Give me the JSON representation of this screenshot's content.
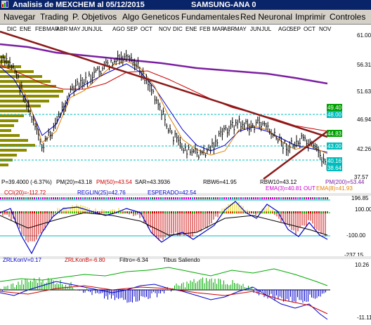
{
  "window": {
    "title": "Analisis de MEXCHEM al 05/12/2015",
    "subtitle": "SAMSUNG-ANA 0"
  },
  "menu": [
    "Navegar",
    "Trading",
    "P. Objetivos",
    "Algo Geneticos",
    "Fundamentales",
    "Red Neuronal",
    "Imprimir",
    "Controles"
  ],
  "colors": {
    "price_bars": "#000000",
    "trend_line": "#8b1a1a",
    "ma_purple": "#7b1fa2",
    "ma_red": "#cc0000",
    "ma_blue": "#0000cc",
    "ma_orange": "#e08000",
    "volume_profile": "#8b8b00",
    "level_cyan": "#00aaaa"
  },
  "price_panel": {
    "months": [
      "DIC",
      "ENE",
      "FEB",
      "MAR",
      "ABR",
      "MAY",
      "JUN",
      "JUL",
      "AGO",
      "SEP",
      "OCT",
      "NOV",
      "DIC",
      "ENE",
      "FEB",
      "MAR",
      "ABR",
      "MAY",
      "JUN",
      "JUL",
      "AGO",
      "SEP",
      "OCT",
      "NOV"
    ],
    "y_ticks": [
      "61.00",
      "56.31",
      "51.63",
      "46.94",
      "42.26",
      "37.57"
    ],
    "level_boxes": [
      {
        "label": "49.40",
        "color": "#00a000"
      },
      {
        "label": "48.00",
        "color": "#00bcbc"
      },
      {
        "label": "44.83",
        "color": "#00a000"
      },
      {
        "label": "43.00",
        "color": "#00bcbc"
      },
      {
        "label": "40.16",
        "color": "#00bcbc"
      },
      {
        "label": "38.64",
        "color": "#00bcbc"
      }
    ],
    "stats_line": [
      "P=39.4000 (-6.37%)",
      "PM(20)=43.18",
      "PM(50)=43.54",
      "SAR=43.3936",
      "RBW6=41.95",
      "RBW10=43.12",
      "PM(200)=53.44"
    ],
    "ema_line": [
      "EMA(3)=40.81 OUT",
      "EMA(8)=41.93"
    ]
  },
  "cci_panel": {
    "labels": [
      "CCI(20)=-112.72",
      "REGLIN(25)=42.76",
      "ESPERADO=42.54"
    ],
    "y_ticks": [
      "196.85",
      "100.00",
      "-100.00",
      "-237.15"
    ]
  },
  "zrl_panel": {
    "labels": [
      "ZRLKonV=0.17",
      "ZRLKonB=-6.80",
      "Filtro=-6.34",
      "Tibus Saliendo"
    ],
    "y_ticks": [
      "10.26",
      "-11.11"
    ]
  }
}
